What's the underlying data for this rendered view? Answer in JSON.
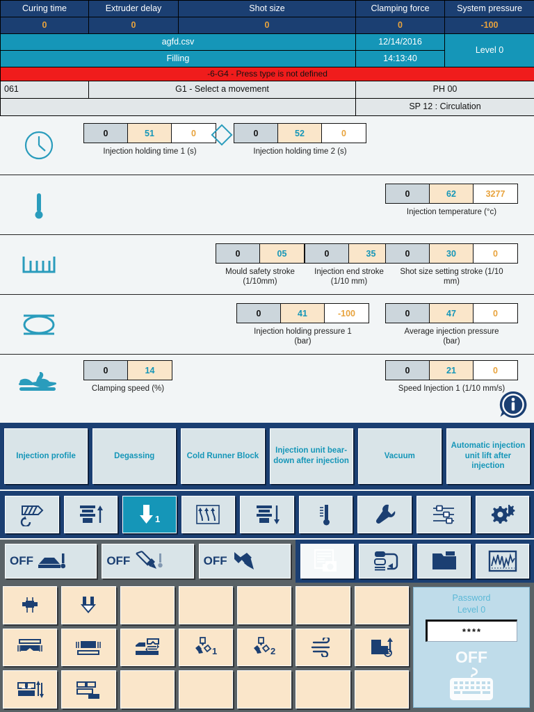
{
  "status_table": {
    "headers": [
      "Curing time",
      "Extruder delay",
      "Shot size",
      "Clamping force",
      "System pressure"
    ],
    "values": [
      "0",
      "0",
      "0",
      "0",
      "-100"
    ],
    "file_name": "agfd.csv",
    "date": "12/14/2016",
    "level": "Level 0",
    "phase": "Filling",
    "time": "14:13:40",
    "alarm": "-6-G4 - Press type is not defined",
    "code": "061",
    "message": "G1 - Select a movement",
    "ph": "PH 00",
    "sp": "SP 12 : Circulation"
  },
  "parameters": {
    "rows": [
      {
        "icon": "clock-icon",
        "fields": [
          {
            "label": "Injection holding time 1 (s)",
            "cells": [
              "0",
              "51",
              "0"
            ]
          },
          {
            "label": "Injection holding time 2 (s)",
            "cells": [
              "0",
              "52",
              "0"
            ]
          }
        ]
      },
      {
        "icon": "thermometer-icon",
        "fields": [
          {
            "label": "Injection temperature (°c)",
            "cells": [
              "0",
              "62",
              "3277"
            ]
          }
        ]
      },
      {
        "icon": "ruler-icon",
        "fields": [
          {
            "label": "Mould safety stroke (1/10mm)",
            "cells": [
              "0",
              "05"
            ]
          },
          {
            "label": "Injection end stroke (1/10 mm)",
            "cells": [
              "0",
              "35"
            ]
          },
          {
            "label": "Shot size setting stroke (1/10 mm)",
            "cells": [
              "0",
              "30",
              "0"
            ]
          }
        ]
      },
      {
        "icon": "pressure-icon",
        "fields": [
          {
            "label": "Injection holding pressure 1 (bar)",
            "cells": [
              "0",
              "41",
              "-100"
            ]
          },
          {
            "label": "Average injection pressure (bar)",
            "cells": [
              "0",
              "47",
              "0"
            ]
          }
        ]
      },
      {
        "icon": "speed-rabbit-icon",
        "fields": [
          {
            "label": "Clamping speed (%)",
            "cells": [
              "0",
              "14"
            ]
          },
          {
            "label": "Speed Injection 1 (1/10 mm/s)",
            "cells": [
              "0",
              "21",
              "0"
            ]
          }
        ]
      }
    ]
  },
  "function_buttons": [
    "Injection profile",
    "Degassing",
    "Cold Runner Block",
    "Injection unit bear-down after injection",
    "Vacuum",
    "Automatic injection unit lift after injection"
  ],
  "toolbar": {
    "icons": [
      "screw-rotation-icon",
      "mould-open-up-icon",
      "injection-down-1-icon",
      "ejector-up-icon",
      "mould-close-down-icon",
      "temperature-icon",
      "wrench-icon",
      "sliders-icon",
      "gears-icon"
    ],
    "active_index": 2,
    "active_badge": "1"
  },
  "toggle_row": {
    "toggles": [
      {
        "state": "OFF",
        "icon": "mould-heating-icon"
      },
      {
        "state": "OFF",
        "icon": "nozzle-heating-icon"
      },
      {
        "state": "OFF",
        "icon": "nozzle-icon"
      }
    ],
    "right_icons": [
      {
        "icon": "screenshot-camera-icon",
        "disabled": true
      },
      {
        "icon": "data-transfer-icon",
        "disabled": false
      },
      {
        "icon": "folder-icon",
        "disabled": false
      },
      {
        "icon": "graph-chart-icon",
        "disabled": false
      }
    ]
  },
  "bottom_grid": [
    "core-pull-icon",
    "ejector-down-icon",
    "",
    "",
    "",
    "",
    "",
    "mould-clamp-top-icon",
    "mould-clamp-bottom-icon",
    "mould-transfer-icon",
    "nozzle-1-icon",
    "nozzle-2-icon",
    "air-blow-icon",
    "lift-timer-icon",
    "mould-updown-icon",
    "mould-shift-icon",
    "",
    "",
    "",
    "",
    ""
  ],
  "password_panel": {
    "title": "Password",
    "level": "Level 0",
    "value": "****",
    "state": "OFF",
    "keyboard_icon": "keyboard-icon"
  },
  "colors": {
    "navy": "#1b3f72",
    "cyan": "#1596b8",
    "alarm_red": "#f01c1c",
    "value_orange": "#e8a33d",
    "beige": "#fae6ca",
    "gray_cell": "#ccd6dc"
  }
}
